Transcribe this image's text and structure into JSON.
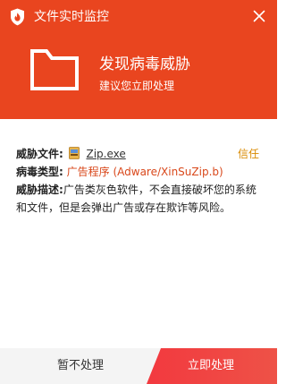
{
  "window": {
    "title": "文件实时监控",
    "icons": {
      "app": "shield-flame-icon",
      "close": "close-icon"
    }
  },
  "colors": {
    "header": "#e9451f",
    "primary_button": "#f0433a",
    "virus_type_text": "#d9481b",
    "trust_link": "#d98a00"
  },
  "alert": {
    "icon": "folder-icon",
    "headline": "发现病毒威胁",
    "subline": "建议您立即处理"
  },
  "details": {
    "file_label": "威胁文件:",
    "file_icon": "exe-file-icon",
    "file_name": "Zip.exe",
    "trust_label": "信任",
    "type_label": "病毒类型:",
    "type_value": "广告程序 (Adware/XinSuZip.b)",
    "desc_label": "威胁描述:",
    "desc_value": "广告类灰色软件，不会直接破坏您的系统和文件，但是会弹出广告或存在欺诈等风险。"
  },
  "footer": {
    "ignore_label": "暂不处理",
    "handle_label": "立即处理"
  }
}
